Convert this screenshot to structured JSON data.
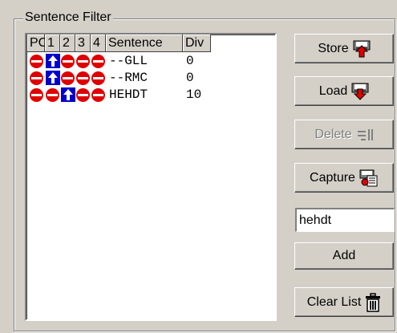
{
  "group": {
    "title": "Sentence Filter"
  },
  "list": {
    "columns": [
      "PC",
      "1",
      "2",
      "3",
      "4",
      "Sentence",
      "Div"
    ],
    "rows": [
      {
        "states": [
          "block",
          "pass",
          "block",
          "block",
          "block"
        ],
        "sentence": "--GLL",
        "div": "0"
      },
      {
        "states": [
          "block",
          "pass",
          "block",
          "block",
          "block"
        ],
        "sentence": "--RMC",
        "div": "0"
      },
      {
        "states": [
          "block",
          "block",
          "pass",
          "block",
          "block"
        ],
        "sentence": "HEHDT",
        "div": "10"
      }
    ]
  },
  "buttons": {
    "store": "Store",
    "load": "Load",
    "delete": "Delete",
    "capture": "Capture",
    "add": "Add",
    "clear": "Clear List"
  },
  "input": {
    "value": "hehdt"
  },
  "icons": {
    "block": "no-entry-icon",
    "pass": "up-arrow-icon",
    "store": "store-disk-icon",
    "load": "load-disk-icon",
    "delete": "delete-lines-icon",
    "capture": "capture-icon",
    "clear": "trash-icon"
  },
  "colors": {
    "block": "#e00000",
    "pass": "#0000cc"
  }
}
